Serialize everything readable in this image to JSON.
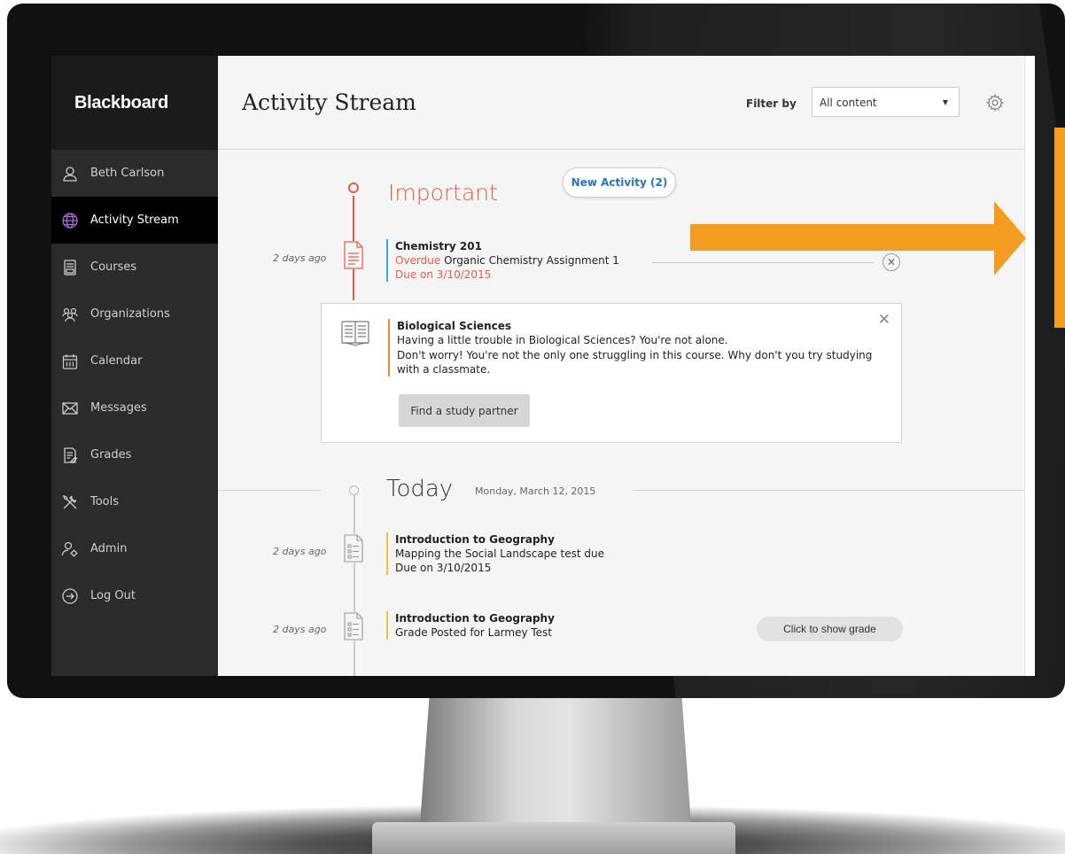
{
  "app": {
    "brand": "Blackboard"
  },
  "sidebar": {
    "items": [
      {
        "label": "Beth Carlson",
        "icon": "user-icon"
      },
      {
        "label": "Activity Stream",
        "icon": "globe-icon",
        "active": true
      },
      {
        "label": "Courses",
        "icon": "courses-icon"
      },
      {
        "label": "Organizations",
        "icon": "organizations-icon"
      },
      {
        "label": "Calendar",
        "icon": "calendar-icon"
      },
      {
        "label": "Messages",
        "icon": "envelope-icon"
      },
      {
        "label": "Grades",
        "icon": "grades-icon"
      },
      {
        "label": "Tools",
        "icon": "tools-icon"
      },
      {
        "label": "Admin",
        "icon": "admin-icon"
      },
      {
        "label": "Log Out",
        "icon": "logout-icon"
      }
    ]
  },
  "header": {
    "title": "Activity Stream",
    "filter_label": "Filter by",
    "filter_value": "All content"
  },
  "stream": {
    "new_activity": "New Activity (2)",
    "important": {
      "heading": "Important",
      "item": {
        "time": "2 days ago",
        "course": "Chemistry 201",
        "status": "Overdue",
        "name": "Organic Chemistry Assignment 1",
        "due": "Due on 3/10/2015"
      },
      "card": {
        "course": "Biological Sciences",
        "headline": "Having a little trouble in Biological Sciences? You're not alone.",
        "body": "Don't worry! You're not the only one struggling in this course. Why don't you try studying with a classmate.",
        "button": "Find a study partner"
      }
    },
    "today": {
      "heading": "Today",
      "date": "Monday, March 12, 2015",
      "items": [
        {
          "time": "2 days ago",
          "course": "Introduction to Geography",
          "line": "Mapping the Social Landscape test due",
          "due": "Due on 3/10/2015"
        },
        {
          "time": "2 days ago",
          "course": "Introduction to Geography",
          "line": "Grade Posted for Larmey Test",
          "button": "Click to show grade"
        }
      ]
    }
  },
  "colors": {
    "accent_red": "#e45b4c",
    "link_blue": "#2a73b8",
    "annotation_orange": "#f39c1f"
  }
}
